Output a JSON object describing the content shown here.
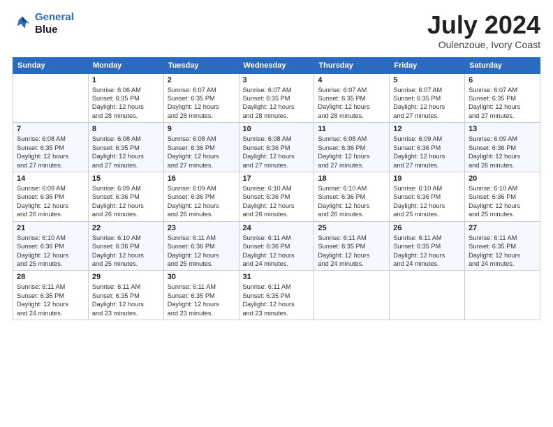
{
  "logo": {
    "line1": "General",
    "line2": "Blue"
  },
  "title": {
    "month_year": "July 2024",
    "location": "Oulenzoue, Ivory Coast"
  },
  "days_of_week": [
    "Sunday",
    "Monday",
    "Tuesday",
    "Wednesday",
    "Thursday",
    "Friday",
    "Saturday"
  ],
  "weeks": [
    [
      {
        "day": "",
        "info": ""
      },
      {
        "day": "1",
        "info": "Sunrise: 6:06 AM\nSunset: 6:35 PM\nDaylight: 12 hours\nand 28 minutes."
      },
      {
        "day": "2",
        "info": "Sunrise: 6:07 AM\nSunset: 6:35 PM\nDaylight: 12 hours\nand 28 minutes."
      },
      {
        "day": "3",
        "info": "Sunrise: 6:07 AM\nSunset: 6:35 PM\nDaylight: 12 hours\nand 28 minutes."
      },
      {
        "day": "4",
        "info": "Sunrise: 6:07 AM\nSunset: 6:35 PM\nDaylight: 12 hours\nand 28 minutes."
      },
      {
        "day": "5",
        "info": "Sunrise: 6:07 AM\nSunset: 6:35 PM\nDaylight: 12 hours\nand 27 minutes."
      },
      {
        "day": "6",
        "info": "Sunrise: 6:07 AM\nSunset: 6:35 PM\nDaylight: 12 hours\nand 27 minutes."
      }
    ],
    [
      {
        "day": "7",
        "info": "Sunrise: 6:08 AM\nSunset: 6:35 PM\nDaylight: 12 hours\nand 27 minutes."
      },
      {
        "day": "8",
        "info": "Sunrise: 6:08 AM\nSunset: 6:35 PM\nDaylight: 12 hours\nand 27 minutes."
      },
      {
        "day": "9",
        "info": "Sunrise: 6:08 AM\nSunset: 6:36 PM\nDaylight: 12 hours\nand 27 minutes."
      },
      {
        "day": "10",
        "info": "Sunrise: 6:08 AM\nSunset: 6:36 PM\nDaylight: 12 hours\nand 27 minutes."
      },
      {
        "day": "11",
        "info": "Sunrise: 6:08 AM\nSunset: 6:36 PM\nDaylight: 12 hours\nand 27 minutes."
      },
      {
        "day": "12",
        "info": "Sunrise: 6:09 AM\nSunset: 6:36 PM\nDaylight: 12 hours\nand 27 minutes."
      },
      {
        "day": "13",
        "info": "Sunrise: 6:09 AM\nSunset: 6:36 PM\nDaylight: 12 hours\nand 26 minutes."
      }
    ],
    [
      {
        "day": "14",
        "info": "Sunrise: 6:09 AM\nSunset: 6:36 PM\nDaylight: 12 hours\nand 26 minutes."
      },
      {
        "day": "15",
        "info": "Sunrise: 6:09 AM\nSunset: 6:36 PM\nDaylight: 12 hours\nand 26 minutes."
      },
      {
        "day": "16",
        "info": "Sunrise: 6:09 AM\nSunset: 6:36 PM\nDaylight: 12 hours\nand 26 minutes."
      },
      {
        "day": "17",
        "info": "Sunrise: 6:10 AM\nSunset: 6:36 PM\nDaylight: 12 hours\nand 26 minutes."
      },
      {
        "day": "18",
        "info": "Sunrise: 6:10 AM\nSunset: 6:36 PM\nDaylight: 12 hours\nand 26 minutes."
      },
      {
        "day": "19",
        "info": "Sunrise: 6:10 AM\nSunset: 6:36 PM\nDaylight: 12 hours\nand 25 minutes."
      },
      {
        "day": "20",
        "info": "Sunrise: 6:10 AM\nSunset: 6:36 PM\nDaylight: 12 hours\nand 25 minutes."
      }
    ],
    [
      {
        "day": "21",
        "info": "Sunrise: 6:10 AM\nSunset: 6:36 PM\nDaylight: 12 hours\nand 25 minutes."
      },
      {
        "day": "22",
        "info": "Sunrise: 6:10 AM\nSunset: 6:36 PM\nDaylight: 12 hours\nand 25 minutes."
      },
      {
        "day": "23",
        "info": "Sunrise: 6:11 AM\nSunset: 6:36 PM\nDaylight: 12 hours\nand 25 minutes."
      },
      {
        "day": "24",
        "info": "Sunrise: 6:11 AM\nSunset: 6:36 PM\nDaylight: 12 hours\nand 24 minutes."
      },
      {
        "day": "25",
        "info": "Sunrise: 6:11 AM\nSunset: 6:35 PM\nDaylight: 12 hours\nand 24 minutes."
      },
      {
        "day": "26",
        "info": "Sunrise: 6:11 AM\nSunset: 6:35 PM\nDaylight: 12 hours\nand 24 minutes."
      },
      {
        "day": "27",
        "info": "Sunrise: 6:11 AM\nSunset: 6:35 PM\nDaylight: 12 hours\nand 24 minutes."
      }
    ],
    [
      {
        "day": "28",
        "info": "Sunrise: 6:11 AM\nSunset: 6:35 PM\nDaylight: 12 hours\nand 24 minutes."
      },
      {
        "day": "29",
        "info": "Sunrise: 6:11 AM\nSunset: 6:35 PM\nDaylight: 12 hours\nand 23 minutes."
      },
      {
        "day": "30",
        "info": "Sunrise: 6:11 AM\nSunset: 6:35 PM\nDaylight: 12 hours\nand 23 minutes."
      },
      {
        "day": "31",
        "info": "Sunrise: 6:11 AM\nSunset: 6:35 PM\nDaylight: 12 hours\nand 23 minutes."
      },
      {
        "day": "",
        "info": ""
      },
      {
        "day": "",
        "info": ""
      },
      {
        "day": "",
        "info": ""
      }
    ]
  ]
}
